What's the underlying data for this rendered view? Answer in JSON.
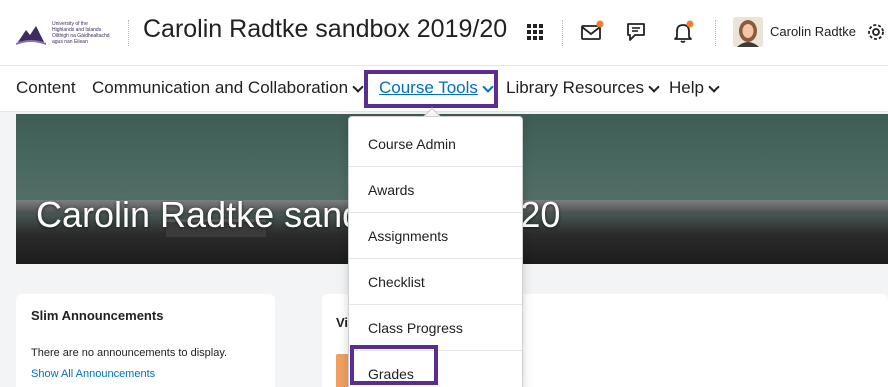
{
  "header": {
    "logo_lines": [
      "University of the",
      "Highlands and Islands",
      "Oilthigh na Gàidhealtachd",
      "agus nan Eilean"
    ],
    "course_title": "Carolin Radtke sandbox 2019/20",
    "icons": [
      "apps-grid-icon",
      "mail-icon",
      "chat-icon",
      "bell-icon",
      "settings-gear-icon"
    ],
    "notification_dot_color": "#f47e2b",
    "user_name": "Carolin Radtke"
  },
  "nav": {
    "items": [
      {
        "label": "Content",
        "has_dropdown": false
      },
      {
        "label": "Communication and Collaboration",
        "has_dropdown": true
      },
      {
        "label": "Course Tools",
        "has_dropdown": true,
        "active": true
      },
      {
        "label": "Library Resources",
        "has_dropdown": true
      },
      {
        "label": "Help",
        "has_dropdown": true
      }
    ],
    "highlight_color": "#5b2d91",
    "link_color": "#006fbf"
  },
  "banner": {
    "title": "Carolin Radtke sandbox 2019/20"
  },
  "dropdown": {
    "items": [
      "Course Admin",
      "Awards",
      "Assignments",
      "Checklist",
      "Class Progress",
      "Grades"
    ],
    "highlighted": "Grades"
  },
  "announcements": {
    "title": "Slim Announcements",
    "empty_text": "There are no announcements to display.",
    "link": "Show All Announcements"
  },
  "video_card": {
    "title_visible": "Vi"
  }
}
